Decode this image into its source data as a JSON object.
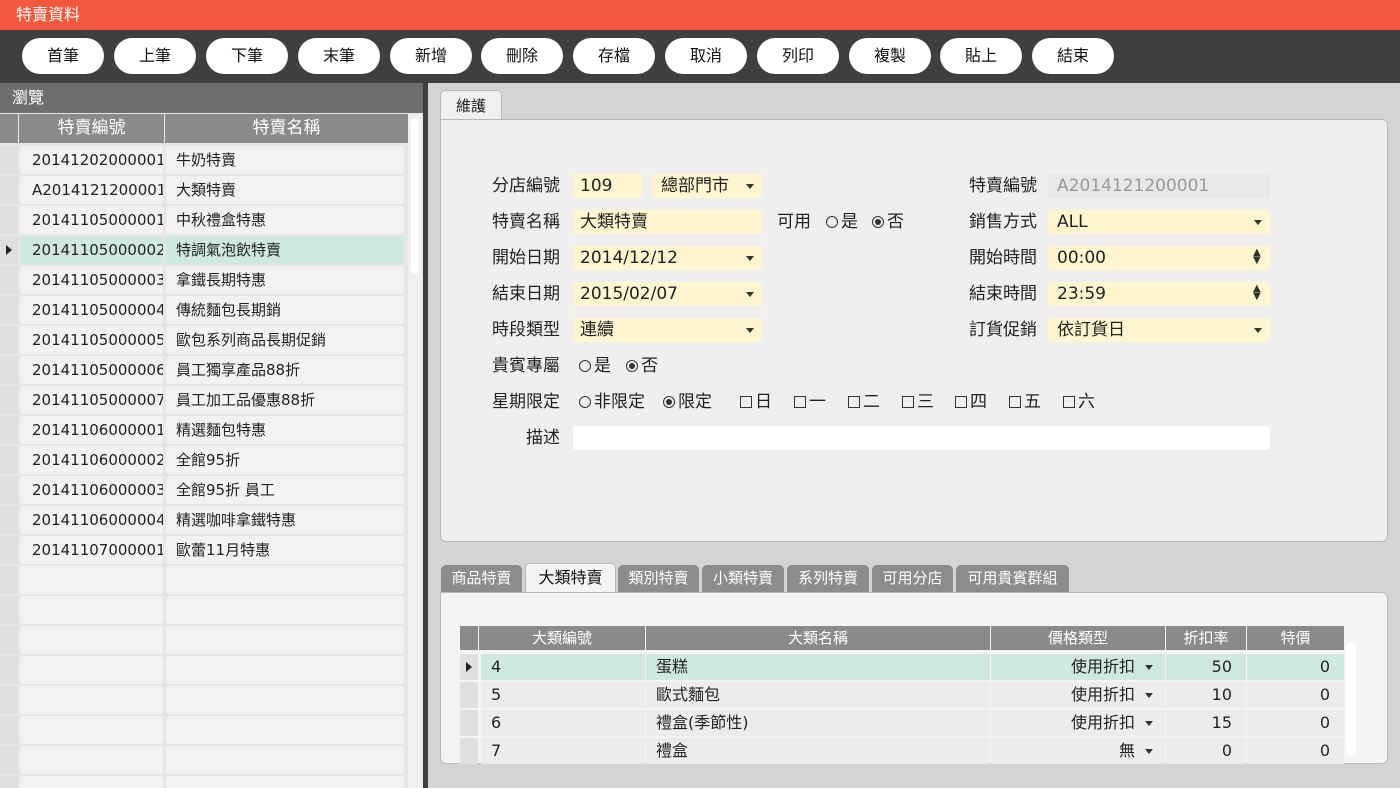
{
  "window": {
    "title": "特賣資料"
  },
  "toolbar": {
    "buttons": [
      "首筆",
      "上筆",
      "下筆",
      "末筆",
      "新增",
      "刪除",
      "存檔",
      "取消",
      "列印",
      "複製",
      "貼上",
      "結束"
    ]
  },
  "browse": {
    "title": "瀏覽",
    "columns": [
      "特賣編號",
      "特賣名稱"
    ],
    "selected_index": 3,
    "rows": [
      {
        "id": "20141202000001",
        "name": "牛奶特賣"
      },
      {
        "id": "A2014121200001",
        "name": "大類特賣"
      },
      {
        "id": "20141105000001",
        "name": "中秋禮盒特惠"
      },
      {
        "id": "20141105000002",
        "name": "特調氣泡飲特賣"
      },
      {
        "id": "20141105000003",
        "name": "拿鐵長期特惠"
      },
      {
        "id": "20141105000004",
        "name": "傳統麵包長期銷"
      },
      {
        "id": "20141105000005",
        "name": "歐包系列商品長期促銷"
      },
      {
        "id": "20141105000006",
        "name": "員工獨享產品88折"
      },
      {
        "id": "20141105000007",
        "name": "員工加工品優惠88折"
      },
      {
        "id": "20141106000001",
        "name": "精選麵包特惠"
      },
      {
        "id": "20141106000002",
        "name": "全館95折"
      },
      {
        "id": "20141106000003",
        "name": "全館95折 員工"
      },
      {
        "id": "20141106000004",
        "name": "精選咖啡拿鐵特惠"
      },
      {
        "id": "20141107000001",
        "name": "歐蕾11月特惠"
      },
      {
        "id": "",
        "name": ""
      },
      {
        "id": "",
        "name": ""
      },
      {
        "id": "",
        "name": ""
      },
      {
        "id": "",
        "name": ""
      },
      {
        "id": "",
        "name": ""
      },
      {
        "id": "",
        "name": ""
      },
      {
        "id": "",
        "name": ""
      },
      {
        "id": "",
        "name": ""
      }
    ]
  },
  "maintenance": {
    "tab_label": "維護",
    "branch_no_label": "分店編號",
    "branch_no": "109",
    "branch_name": "總部門市",
    "sale_no_label": "特賣編號",
    "sale_no": "A2014121200001",
    "sale_name_label": "特賣名稱",
    "sale_name": "大類特賣",
    "available_label": "可用",
    "yes": "是",
    "no": "否",
    "available_value": "否",
    "sales_method_label": "銷售方式",
    "sales_method": "ALL",
    "start_date_label": "開始日期",
    "start_date": "2014/12/12",
    "start_time_label": "開始時間",
    "start_time": "00:00",
    "end_date_label": "結束日期",
    "end_date": "2015/02/07",
    "end_time_label": "結束時間",
    "end_time": "23:59",
    "period_type_label": "時段類型",
    "period_type": "連續",
    "order_promo_label": "訂貨促銷",
    "order_promo": "依訂貨日",
    "vip_only_label": "貴賓專屬",
    "vip_only_value": "否",
    "weekday_limit_label": "星期限定",
    "not_limited": "非限定",
    "limited": "限定",
    "weekday_limit_value": "限定",
    "weekdays": [
      "日",
      "一",
      "二",
      "三",
      "四",
      "五",
      "六"
    ],
    "description_label": "描述",
    "description": ""
  },
  "detail_tabs": {
    "tabs": [
      "商品特賣",
      "大類特賣",
      "類別特賣",
      "小類特賣",
      "系列特賣",
      "可用分店",
      "可用貴賓群組"
    ],
    "active_index": 1
  },
  "category_grid": {
    "columns": [
      "大類編號",
      "大類名稱",
      "價格類型",
      "折扣率",
      "特價"
    ],
    "selected_index": 0,
    "rows": [
      {
        "code": "4",
        "name": "蛋糕",
        "price_type": "使用折扣",
        "discount": "50",
        "special": "0"
      },
      {
        "code": "5",
        "name": "歐式麵包",
        "price_type": "使用折扣",
        "discount": "10",
        "special": "0"
      },
      {
        "code": "6",
        "name": "禮盒(季節性)",
        "price_type": "使用折扣",
        "discount": "15",
        "special": "0"
      },
      {
        "code": "7",
        "name": "禮盒",
        "price_type": "無",
        "discount": "0",
        "special": "0"
      }
    ]
  },
  "colors": {
    "title_bar": "#f2583e",
    "toolbar": "#3f3f3f",
    "selected_row": "#cfe9e0",
    "editable_field": "#fff6cf"
  }
}
